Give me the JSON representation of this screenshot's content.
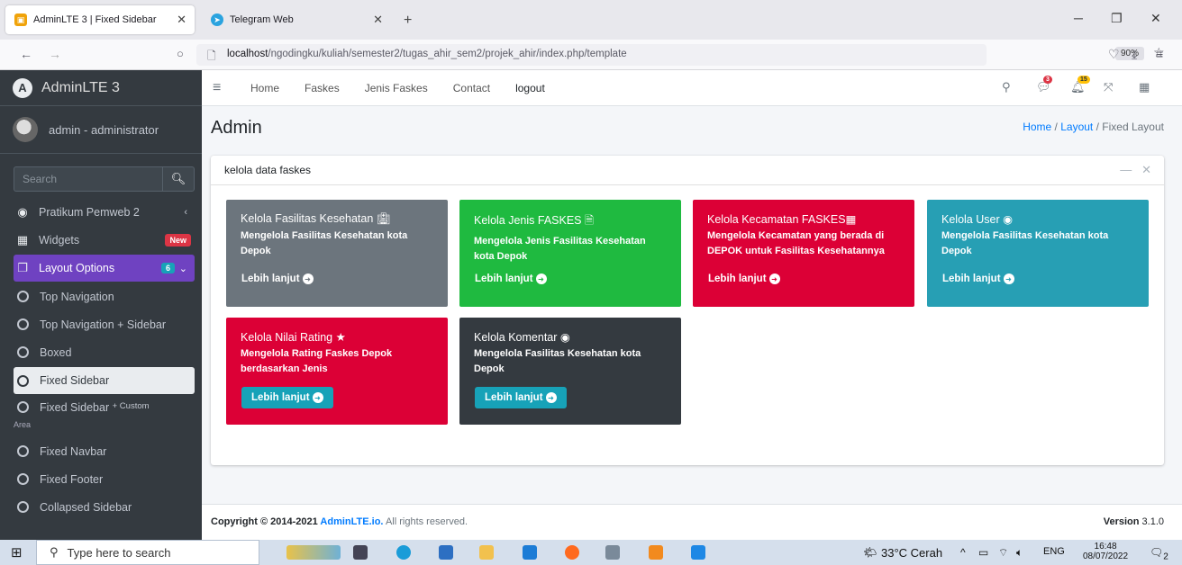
{
  "browser": {
    "tabs": [
      {
        "title": "AdminLTE 3 | Fixed Sidebar",
        "active": true
      },
      {
        "title": "Telegram Web",
        "active": false
      }
    ],
    "new_tab": "+",
    "url_host": "localhost",
    "url_path": "/ngodingku/kuliah/semester2/tugas_ahir_sem2/projek_ahir/index.php/template",
    "zoom": "90%"
  },
  "sidebar": {
    "brand": "AdminLTE 3",
    "user": "admin - administrator",
    "search_placeholder": "Search",
    "items": [
      {
        "label": "Pratikum Pemweb 2"
      },
      {
        "label": "Widgets",
        "badge": "New"
      },
      {
        "label": "Layout Options",
        "badge": "6"
      },
      {
        "label": "Top Navigation"
      },
      {
        "label": "Top Navigation + Sidebar"
      },
      {
        "label": "Boxed"
      },
      {
        "label": "Fixed Sidebar"
      },
      {
        "label": "Fixed Sidebar",
        "suffix": "+ Custom",
        "suffix2": "Area"
      },
      {
        "label": "Fixed Navbar"
      },
      {
        "label": "Fixed Footer"
      },
      {
        "label": "Collapsed Sidebar"
      }
    ]
  },
  "topnav": {
    "links": [
      "Home",
      "Faskes",
      "Jenis Faskes",
      "Contact",
      "logout"
    ],
    "messages_badge": "3",
    "notifications_badge": "15"
  },
  "content": {
    "title": "Admin",
    "breadcrumb": [
      "Home",
      "Layout",
      "Fixed Layout"
    ],
    "card_title": "kelola data faskes",
    "boxes": [
      {
        "title": "Kelola Fasilitas Kesehatan",
        "icon": "hospital-icon",
        "desc": "Mengelola Fasilitas Kesehatan kota Depok",
        "more": "Lebih lanjut",
        "color": "#6c757d"
      },
      {
        "title": "Kelola Jenis FASKES",
        "icon": "file-icon",
        "desc": "Mengelola Jenis Fasilitas Kesehatan kota Depok",
        "more": "Lebih lanjut",
        "color": "#1fba40"
      },
      {
        "title": "Kelola Kecamatan FASKES",
        "icon": "grid-icon",
        "desc": "Mengelola Kecamatan yang berada di DEPOK untuk Fasilitas Kesehatannya",
        "more": "Lebih lanjut",
        "color": "#dc0036"
      },
      {
        "title": "Kelola User",
        "icon": "user-circle-icon",
        "desc": "Mengelola Fasilitas Kesehatan kota Depok",
        "more": "Lebih lanjut",
        "color": "#279fb4"
      },
      {
        "title": "Kelola Nilai Rating",
        "icon": "star-icon",
        "desc": "Mengelola Rating Faskes Depok berdasarkan Jenis",
        "more": "Lebih lanjut",
        "color": "#dc0036"
      },
      {
        "title": "Kelola Komentar",
        "icon": "user-circle-icon",
        "desc": "Mengelola Fasilitas Kesehatan kota Depok",
        "more": "Lebih lanjut",
        "color": "#343a40"
      }
    ]
  },
  "footer": {
    "copyright_prefix": "Copyright © 2014-2021 ",
    "brand": "AdminLTE.io.",
    "suffix": " All rights reserved.",
    "version_label": "Version",
    "version": "3.1.0"
  },
  "taskbar": {
    "search_placeholder": "Type here to search",
    "weather": "33°C Cerah",
    "lang": "ENG",
    "time": "16:48",
    "date": "08/07/2022",
    "notif_count": "2"
  }
}
